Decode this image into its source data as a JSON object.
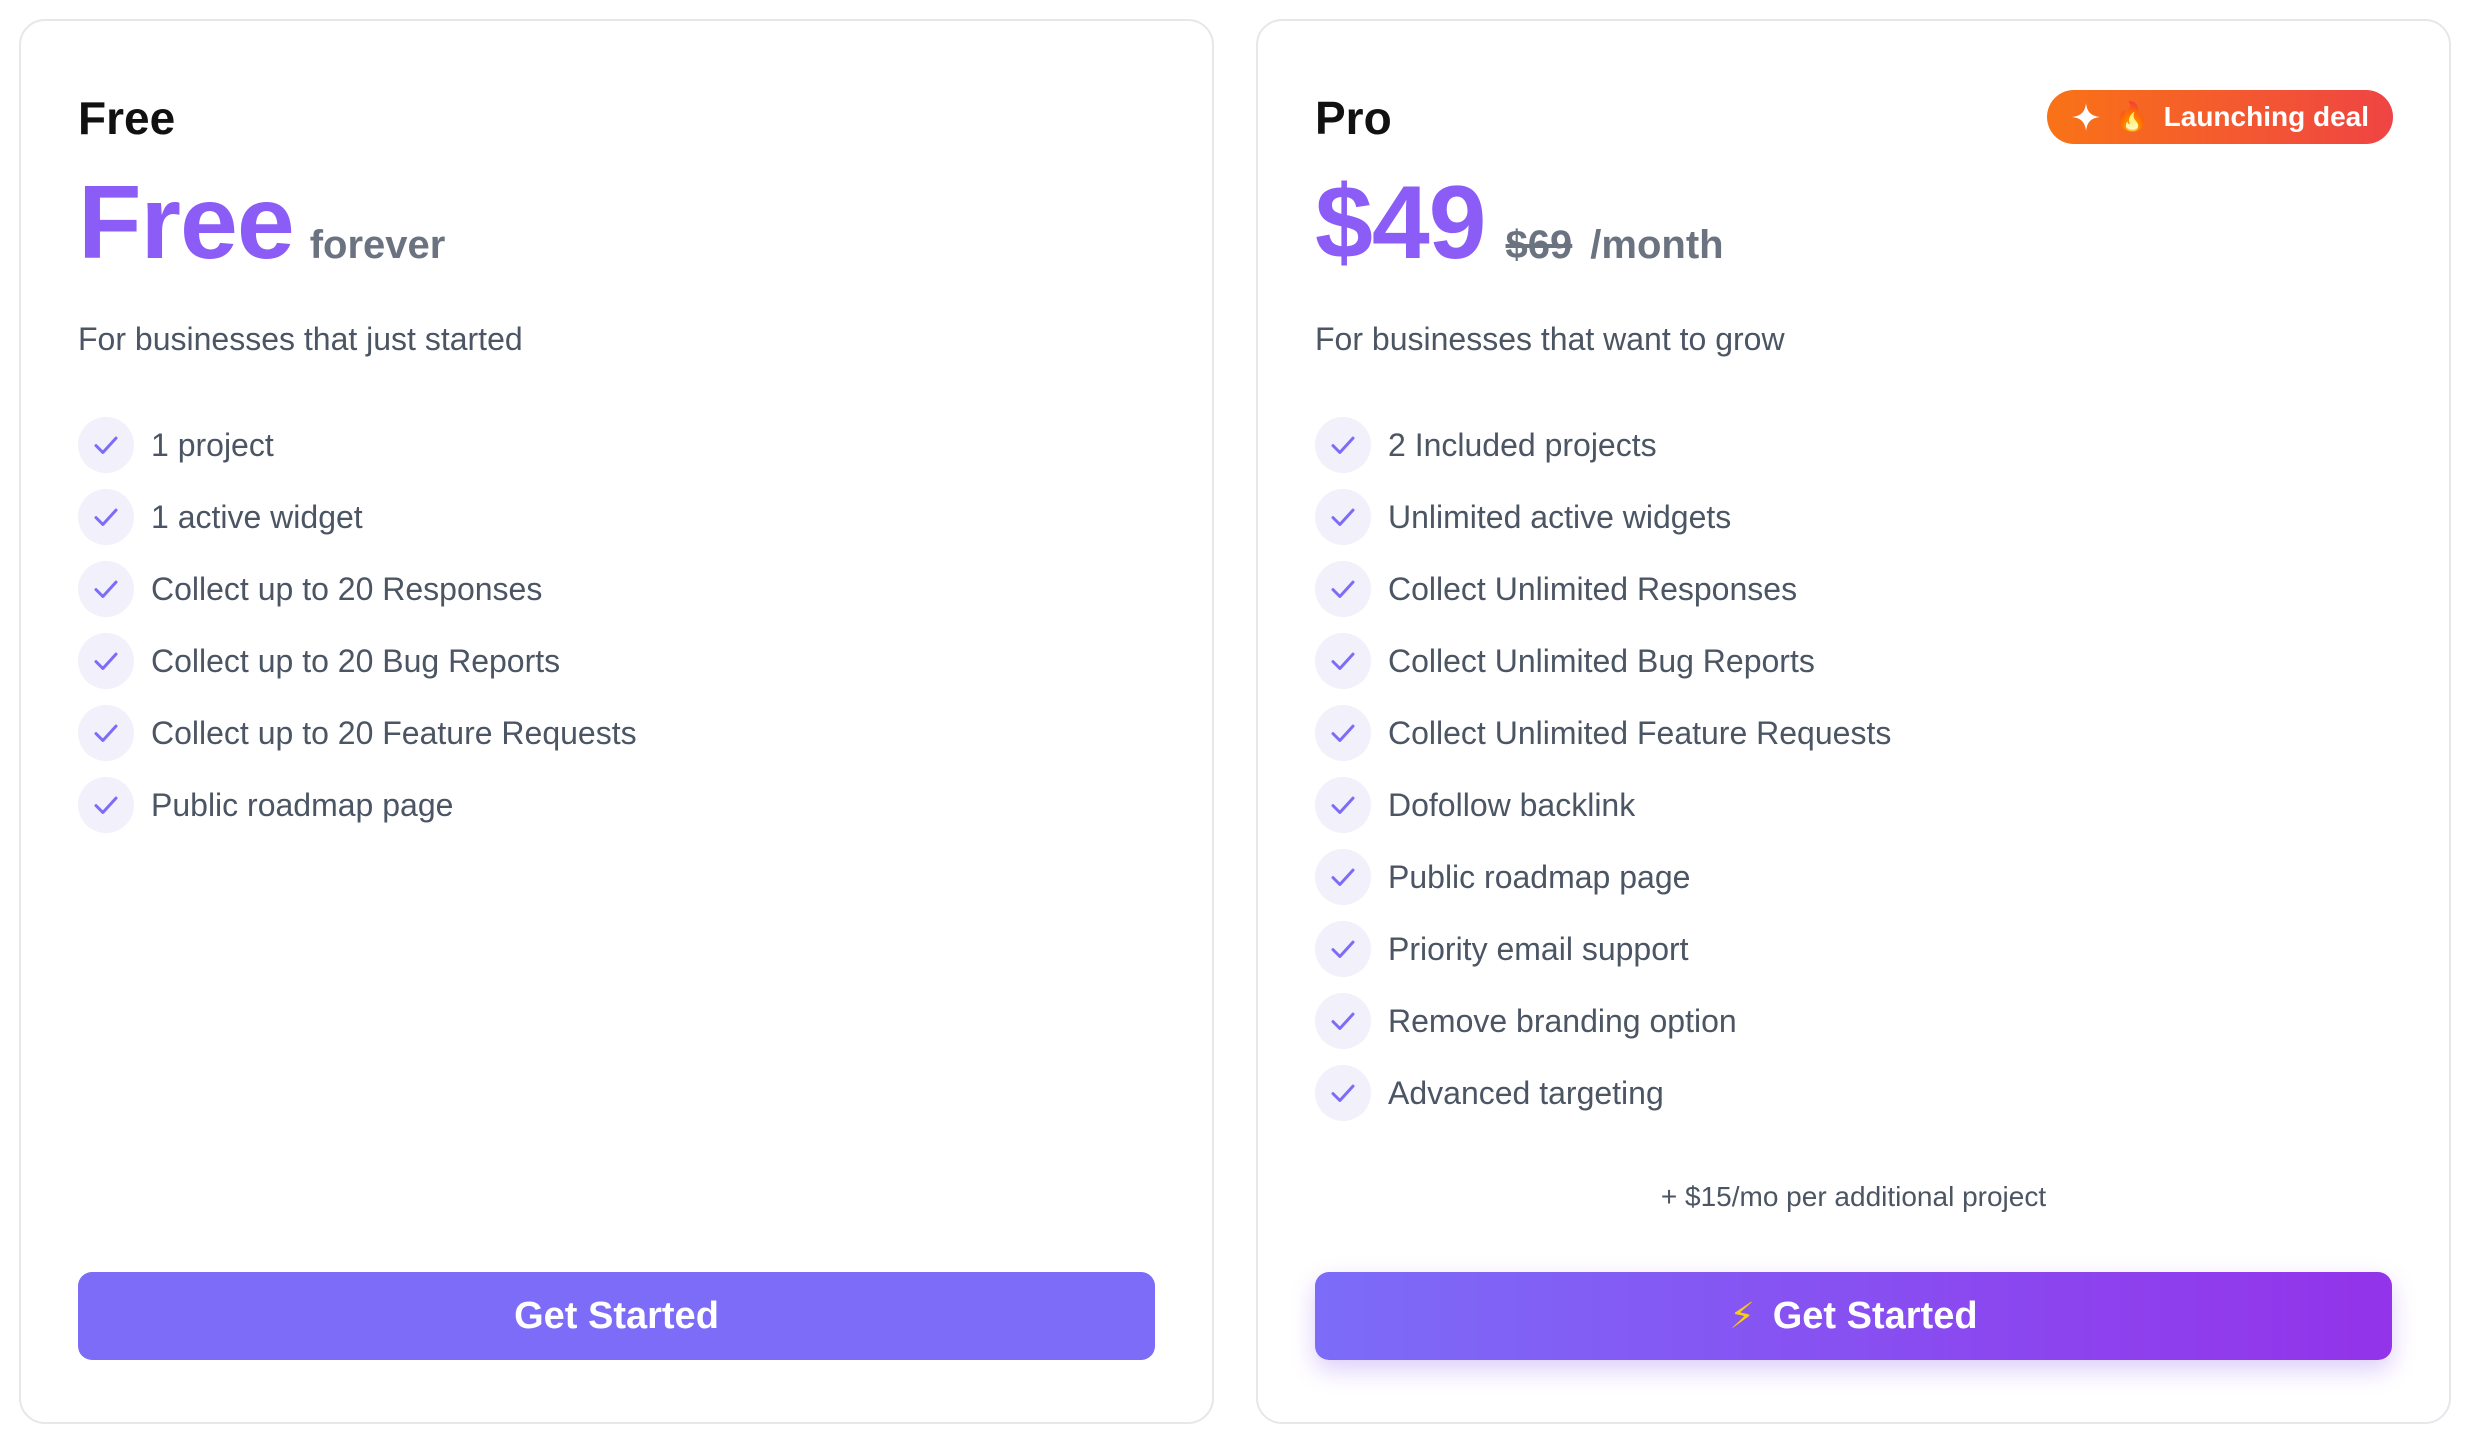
{
  "plans": {
    "free": {
      "name": "Free",
      "price": "Free",
      "price_suffix": "forever",
      "description": "For businesses that just started",
      "features": [
        "1 project",
        "1 active widget",
        "Collect up to 20 Responses",
        "Collect up to 20 Bug Reports",
        "Collect up to 20 Feature Requests",
        "Public roadmap page"
      ],
      "cta_label": "Get Started"
    },
    "pro": {
      "name": "Pro",
      "badge_label": "Launching deal",
      "price": "$49",
      "old_price": "$69",
      "price_suffix": "/month",
      "description": "For businesses that want to grow",
      "features": [
        "2 Included projects",
        "Unlimited active widgets",
        "Collect Unlimited Responses",
        "Collect Unlimited Bug Reports",
        "Collect Unlimited Feature Requests",
        "Dofollow backlink",
        "Public roadmap page",
        "Priority email support",
        "Remove branding option",
        "Advanced targeting"
      ],
      "extra_note": "+ $15/mo per additional project",
      "cta_label": "Get Started"
    }
  },
  "icons": {
    "feature_check": "check-icon",
    "badge_sparkle": "sparkle-icon",
    "badge_flame": "flame-icon",
    "cta_bolt": "lightning-bolt-icon"
  },
  "colors": {
    "accent": "#8b5cf6",
    "button": "#7c6cf8",
    "button_gradient_end": "#9333ea",
    "badge_start": "#f97316",
    "badge_end": "#ef4444",
    "check_bg": "#f1f0fb"
  }
}
